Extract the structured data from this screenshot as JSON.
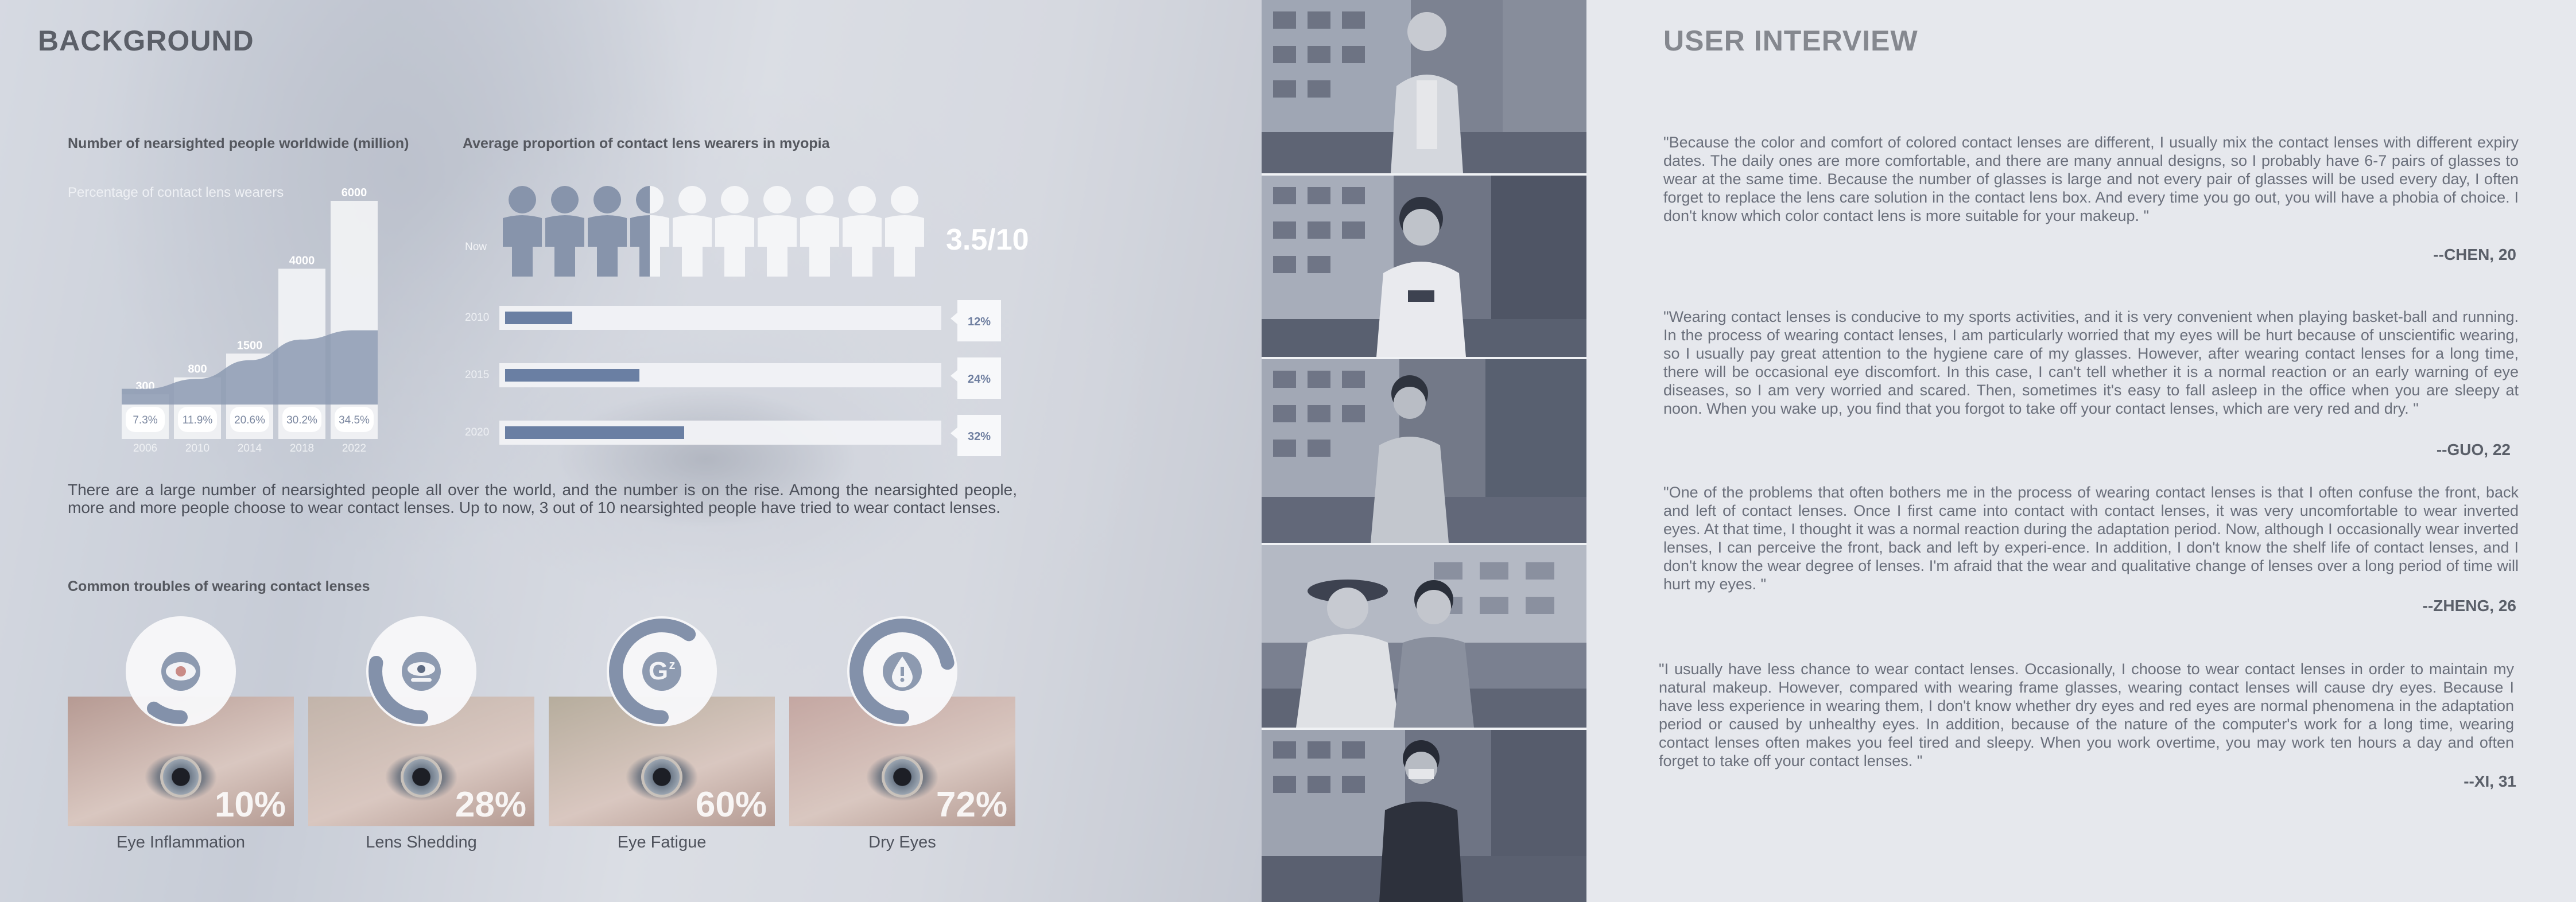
{
  "left": {
    "title": "BACKGROUND",
    "chart1": {
      "title": "Number of nearsighted people worldwide (million)",
      "legend": "Percentage of contact lens wearers"
    },
    "chart2": {
      "title": "Average proportion of contact lens wearers in myopia",
      "now_label": "Now",
      "ratio": "3.5/10"
    },
    "paragraph": "There are a large number of nearsighted people all over the world, and the number is on the rise. Among the nearsighted people, more and more people choose to wear contact lenses. Up to now, 3 out of 10 nearsighted people have tried to wear contact lenses.",
    "troubles_title": "Common troubles of wearing contact lenses",
    "troubles": [
      {
        "label": "Eye Inflammation",
        "percent": "10%",
        "value": 10,
        "icon": "eye-inflammation-icon"
      },
      {
        "label": "Lens Shedding",
        "percent": "28%",
        "value": 28,
        "icon": "lens-shedding-icon"
      },
      {
        "label": "Eye Fatigue",
        "percent": "60%",
        "value": 60,
        "icon": "eye-fatigue-icon"
      },
      {
        "label": "Dry Eyes",
        "percent": "72%",
        "value": 72,
        "icon": "dry-eyes-icon"
      }
    ]
  },
  "chart_data": [
    {
      "type": "bar",
      "title": "Number of nearsighted people worldwide (million)",
      "categories": [
        "2006",
        "2010",
        "2014",
        "2018",
        "2022"
      ],
      "series": [
        {
          "name": "Number of nearsighted people worldwide (million)",
          "values": [
            300,
            800,
            1500,
            4000,
            6000
          ]
        },
        {
          "name": "Percentage of contact lens wearers",
          "values": [
            7.3,
            11.9,
            20.6,
            30.2,
            34.5
          ],
          "labels": [
            "7.3%",
            "11.9%",
            "20.6%",
            "30.2%",
            "34.5%"
          ]
        }
      ],
      "ylim": [
        0,
        6000
      ]
    },
    {
      "type": "bar",
      "title": "Average proportion of contact lens wearers in myopia",
      "categories": [
        "2010",
        "2015",
        "2020"
      ],
      "values": [
        12,
        24,
        32
      ],
      "labels": [
        "12%",
        "24%",
        "32%"
      ],
      "ylim": [
        0,
        100
      ]
    },
    {
      "type": "pie",
      "title": "Common troubles of wearing contact lenses",
      "categories": [
        "Eye Inflammation",
        "Lens Shedding",
        "Eye Fatigue",
        "Dry Eyes"
      ],
      "values": [
        10,
        28,
        60,
        72
      ]
    }
  ],
  "right": {
    "title": "USER INTERVIEW",
    "interviews": [
      {
        "quote": "\"Because the color and comfort of colored contact lenses are different, I usually mix the contact lenses with different expiry dates. The daily ones are more comfortable, and there are many annual designs, so I probably have 6-7 pairs of glasses to wear at the same time. Because the number of glasses is large and not every pair of glasses will be used every day, I often forget to replace the lens care solution in the contact lens box. And every time you go out, you will have a phobia of choice. I don't know which color contact lens is more suitable for your makeup. \"",
        "author": "--CHEN, 20"
      },
      {
        "quote": "\"Wearing contact lenses is conducive to my sports activities, and it is very convenient when playing basket-ball and running. In the process of wearing contact lenses, I am particularly worried that my eyes will be hurt because of unscientific wearing, so I usually pay great attention to the hygiene care of my glasses. However, after wearing contact lenses for a long time, there will be occasional eye discomfort. In this case, I can't tell whether it is a normal reaction or an early warning of eye diseases, so I am very worried and scared. Then, sometimes it's easy to fall asleep in the office when you are sleepy at noon. When you wake up, you find that you forgot to take off your contact lenses, which are very red and dry. \"",
        "author": "--GUO, 22"
      },
      {
        "quote": "\"One of the problems that often bothers me in the process of wearing contact lenses is that I often confuse the front, back and left of contact lenses. Once I first came into contact with contact lenses, it was very uncomfortable to wear inverted eyes. At that time, I thought it was a normal reaction during the adaptation period. Now, although I occasionally wear inverted lenses, I can perceive the front, back and left by experi-ence. In addition, I don't know the shelf life of contact lenses, and I don't know the wear degree of lenses. I'm afraid that the wear and qualitative change of lenses over a long period of time will hurt my eyes. \"",
        "author": "--ZHENG, 26"
      },
      {
        "quote": "\"I usually have less chance to wear contact lenses. Occasionally, I choose to wear contact lenses in order to maintain my natural makeup. However, compared with wearing frame glasses, wearing contact lenses will cause dry eyes. Because I have less experience in wearing them, I don't know whether dry eyes and red eyes are normal phenomena in the adaptation period or caused by unhealthy eyes. In addition, because of the nature of the computer's work for a long time, wearing contact lenses often makes you feel tired and sleepy. When you work overtime, you may work ten hours a day and often forget to take off your contact lenses. \"",
        "author": "--XI, 31"
      }
    ]
  },
  "colors": {
    "bar_fill": "#f2f3f5",
    "area_fill": "#8c9ab1",
    "accent_blue": "#6a7fa3",
    "person_dark": "#8794ab",
    "person_light": "#f4f5f7"
  }
}
